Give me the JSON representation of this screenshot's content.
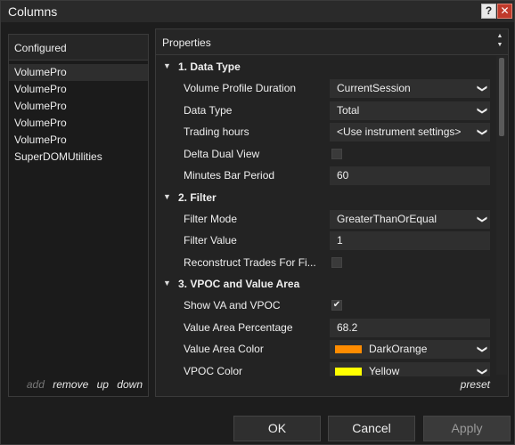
{
  "window": {
    "title": "Columns",
    "help": "?",
    "close": "✕"
  },
  "configured": {
    "header": "Configured",
    "items": [
      "VolumePro",
      "VolumePro",
      "VolumePro",
      "VolumePro",
      "VolumePro",
      "SuperDOMUtilities"
    ],
    "actions": {
      "add": "add",
      "remove": "remove",
      "up": "up",
      "down": "down"
    }
  },
  "properties": {
    "header": "Properties",
    "sections": [
      {
        "title": "1. Data Type",
        "rows": [
          {
            "label": "Volume Profile Duration",
            "value": "CurrentSession",
            "kind": "select"
          },
          {
            "label": "Data Type",
            "value": "Total",
            "kind": "select"
          },
          {
            "label": "Trading hours",
            "value": "<Use instrument settings>",
            "kind": "select"
          },
          {
            "label": "Delta Dual View",
            "value": "",
            "kind": "checkbox",
            "checked": false
          },
          {
            "label": "Minutes Bar Period",
            "value": "60",
            "kind": "text"
          }
        ]
      },
      {
        "title": "2. Filter",
        "rows": [
          {
            "label": "Filter Mode",
            "value": "GreaterThanOrEqual",
            "kind": "select"
          },
          {
            "label": "Filter Value",
            "value": "1",
            "kind": "text"
          },
          {
            "label": "Reconstruct Trades For Fi...",
            "value": "",
            "kind": "checkbox",
            "checked": false
          }
        ]
      },
      {
        "title": "3. VPOC and Value Area",
        "rows": [
          {
            "label": "Show VA and VPOC",
            "value": "",
            "kind": "checkbox",
            "checked": true
          },
          {
            "label": "Value Area Percentage",
            "value": "68.2",
            "kind": "text"
          },
          {
            "label": "Value Area Color",
            "value": "DarkOrange",
            "kind": "color",
            "color": "#ff8c00"
          },
          {
            "label": "VPOC Color",
            "value": "Yellow",
            "kind": "color",
            "color": "#ffff00"
          }
        ]
      }
    ],
    "preset": "preset"
  },
  "buttons": {
    "ok": "OK",
    "cancel": "Cancel",
    "apply": "Apply"
  }
}
